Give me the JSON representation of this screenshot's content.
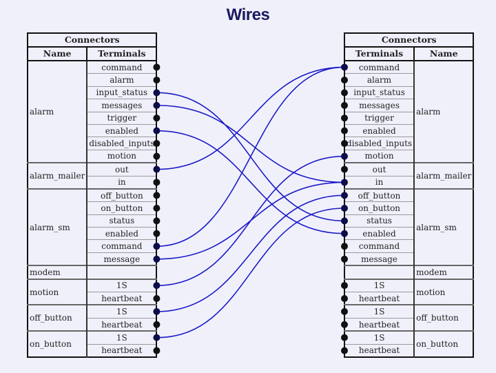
{
  "title": "Wires",
  "left_table": {
    "caption": "Connectors",
    "col_name": "Name",
    "col_terminals": "Terminals",
    "groups": [
      {
        "name": "alarm",
        "terminals": [
          "command",
          "alarm",
          "input_status",
          "messages",
          "trigger",
          "enabled",
          "disabled_inputs",
          "motion"
        ]
      },
      {
        "name": "alarm_mailer",
        "terminals": [
          "out",
          "in"
        ]
      },
      {
        "name": "alarm_sm",
        "terminals": [
          "off_button",
          "on_button",
          "status",
          "enabled",
          "command",
          "message"
        ]
      },
      {
        "name": "modem",
        "terminals": [
          ""
        ]
      },
      {
        "name": "motion",
        "terminals": [
          "1S",
          "heartbeat"
        ]
      },
      {
        "name": "off_button",
        "terminals": [
          "1S",
          "heartbeat"
        ]
      },
      {
        "name": "on_button",
        "terminals": [
          "1S",
          "heartbeat"
        ]
      }
    ]
  },
  "right_table": {
    "caption": "Connectors",
    "col_name": "Name",
    "col_terminals": "Terminals",
    "groups": [
      {
        "name": "alarm",
        "terminals": [
          "command",
          "alarm",
          "input_status",
          "messages",
          "trigger",
          "enabled",
          "disabled_inputs",
          "motion"
        ]
      },
      {
        "name": "alarm_mailer",
        "terminals": [
          "out",
          "in"
        ]
      },
      {
        "name": "alarm_sm",
        "terminals": [
          "off_button",
          "on_button",
          "status",
          "enabled",
          "command",
          "message"
        ]
      },
      {
        "name": "modem",
        "terminals": [
          ""
        ]
      },
      {
        "name": "motion",
        "terminals": [
          "1S",
          "heartbeat"
        ]
      },
      {
        "name": "off_button",
        "terminals": [
          "1S",
          "heartbeat"
        ]
      },
      {
        "name": "on_button",
        "terminals": [
          "1S",
          "heartbeat"
        ]
      }
    ]
  },
  "wires": [
    {
      "from": "alarm.input_status",
      "to": "alarm_sm.status"
    },
    {
      "from": "alarm.messages",
      "to": "alarm_mailer.in"
    },
    {
      "from": "alarm.enabled",
      "to": "alarm_sm.enabled"
    },
    {
      "from": "alarm_mailer.out",
      "to": "alarm.command"
    },
    {
      "from": "alarm_sm.command",
      "to": "alarm.command"
    },
    {
      "from": "alarm_sm.message",
      "to": "alarm_mailer.in"
    },
    {
      "from": "motion.1S",
      "to": "alarm.motion"
    },
    {
      "from": "off_button.1S",
      "to": "alarm_sm.off_button"
    },
    {
      "from": "on_button.1S",
      "to": "alarm_sm.on_button"
    }
  ],
  "colors": {
    "wire": "#1a1ac8",
    "terminal_dot": "#111111",
    "title": "#1a1a5e",
    "background": "#f0f0fb"
  }
}
